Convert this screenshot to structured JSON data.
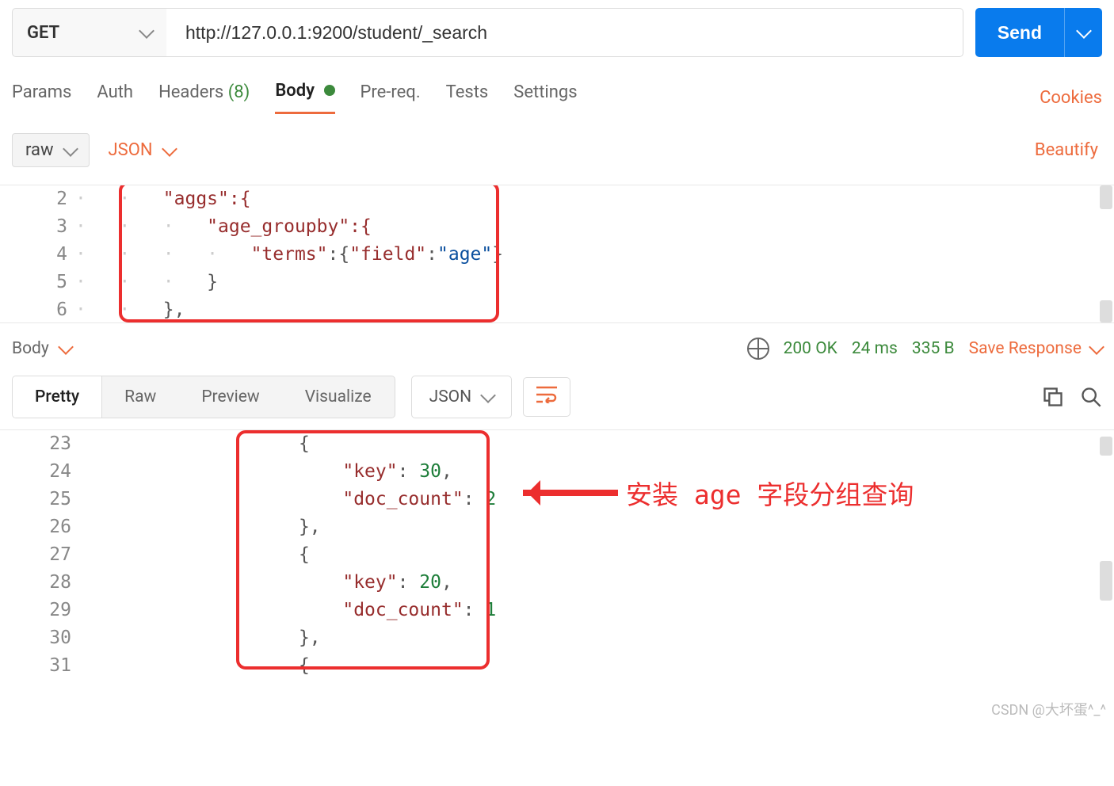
{
  "request": {
    "method": "GET",
    "url": "http://127.0.0.1:9200/student/_search",
    "send_label": "Send"
  },
  "tabs": {
    "params": "Params",
    "auth": "Auth",
    "headers": "Headers",
    "headers_count": "(8)",
    "body": "Body",
    "prereq": "Pre-req.",
    "tests": "Tests",
    "settings": "Settings",
    "cookies": "Cookies"
  },
  "body_toolbar": {
    "raw": "raw",
    "json": "JSON",
    "beautify": "Beautify"
  },
  "request_body": {
    "lines": [
      "2",
      "3",
      "4",
      "5",
      "6"
    ],
    "line2": "\"aggs\":{",
    "line3": "\"age_groupby\":{",
    "line4_key": "\"terms\"",
    "line4_field": "\"field\"",
    "line4_val": "\"age\"",
    "line5": "}",
    "line6": "},"
  },
  "response_header": {
    "body": "Body",
    "status": "200 OK",
    "time": "24 ms",
    "size": "335 B",
    "save": "Save Response"
  },
  "response_tabs": {
    "pretty": "Pretty",
    "raw": "Raw",
    "preview": "Preview",
    "visualize": "Visualize",
    "json": "JSON"
  },
  "response_body": {
    "lines": [
      "23",
      "24",
      "25",
      "26",
      "27",
      "28",
      "29",
      "30",
      "31"
    ],
    "l23": "{",
    "l24_key": "\"key\"",
    "l24_val": "30",
    "l25_key": "\"doc_count\"",
    "l25_val": "2",
    "l26": "},",
    "l27": "{",
    "l28_key": "\"key\"",
    "l28_val": "20",
    "l29_key": "\"doc_count\"",
    "l29_val": "1",
    "l30": "},",
    "l31": "{"
  },
  "annotation": "安装 age 字段分组查询",
  "watermark": "CSDN @大坏蛋^_^",
  "chart_data": {
    "type": "table",
    "title": "Elasticsearch terms aggregation on field 'age'",
    "query": {
      "aggs": {
        "age_groupby": {
          "terms": {
            "field": "age"
          }
        }
      }
    },
    "result_buckets": [
      {
        "key": 30,
        "doc_count": 2
      },
      {
        "key": 20,
        "doc_count": 1
      }
    ]
  }
}
